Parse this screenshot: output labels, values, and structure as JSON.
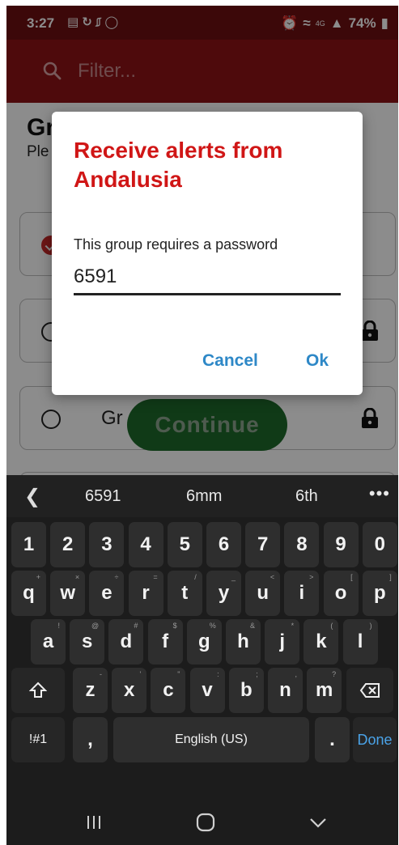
{
  "status_bar": {
    "time": "3:27",
    "battery": "74%",
    "network": "4G"
  },
  "app_bar": {
    "filter_placeholder": "Filter..."
  },
  "page": {
    "title": "Gr",
    "subtitle": "Ple"
  },
  "groups": [
    {
      "label": "",
      "selected": true,
      "locked": false
    },
    {
      "label": "",
      "selected": false,
      "locked": true
    },
    {
      "label": "Gr",
      "selected": false,
      "locked": true
    }
  ],
  "continue_label": "Continue",
  "dialog": {
    "title": "Receive alerts from Andalusia",
    "message": "This group requires a password",
    "password_value": "6591",
    "cancel_label": "Cancel",
    "ok_label": "Ok"
  },
  "keyboard": {
    "suggestions": [
      "6591",
      "6mm",
      "6th"
    ],
    "more": "•••",
    "row_numbers": [
      "1",
      "2",
      "3",
      "4",
      "5",
      "6",
      "7",
      "8",
      "9",
      "0"
    ],
    "row_q": [
      {
        "k": "q",
        "h": "+"
      },
      {
        "k": "w",
        "h": "×"
      },
      {
        "k": "e",
        "h": "÷"
      },
      {
        "k": "r",
        "h": "="
      },
      {
        "k": "t",
        "h": "/"
      },
      {
        "k": "y",
        "h": "_"
      },
      {
        "k": "u",
        "h": "<"
      },
      {
        "k": "i",
        "h": ">"
      },
      {
        "k": "o",
        "h": "["
      },
      {
        "k": "p",
        "h": "]"
      }
    ],
    "row_a": [
      {
        "k": "a",
        "h": "!"
      },
      {
        "k": "s",
        "h": "@"
      },
      {
        "k": "d",
        "h": "#"
      },
      {
        "k": "f",
        "h": "$"
      },
      {
        "k": "g",
        "h": "%"
      },
      {
        "k": "h",
        "h": "&"
      },
      {
        "k": "j",
        "h": "*"
      },
      {
        "k": "k",
        "h": "("
      },
      {
        "k": "l",
        "h": ")"
      }
    ],
    "row_z": [
      {
        "k": "z",
        "h": "-"
      },
      {
        "k": "x",
        "h": "'"
      },
      {
        "k": "c",
        "h": "\""
      },
      {
        "k": "v",
        "h": ":"
      },
      {
        "k": "b",
        "h": ";"
      },
      {
        "k": "n",
        "h": ","
      },
      {
        "k": "m",
        "h": "?"
      }
    ],
    "symbols_label": "!#1",
    "comma_label": ",",
    "space_label": "English (US)",
    "period_label": ".",
    "done_label": "Done"
  },
  "colors": {
    "status_bar": "#6e0f12",
    "app_bar": "#8e1317",
    "dialog_title": "#d01616",
    "dialog_action": "#2e88c7",
    "continue_button": "#1e6a2a"
  },
  "icons": {
    "search": "search-icon",
    "lock": "lock-icon",
    "shift": "shift-icon",
    "backspace": "backspace-icon",
    "back": "chevron-left-icon"
  }
}
